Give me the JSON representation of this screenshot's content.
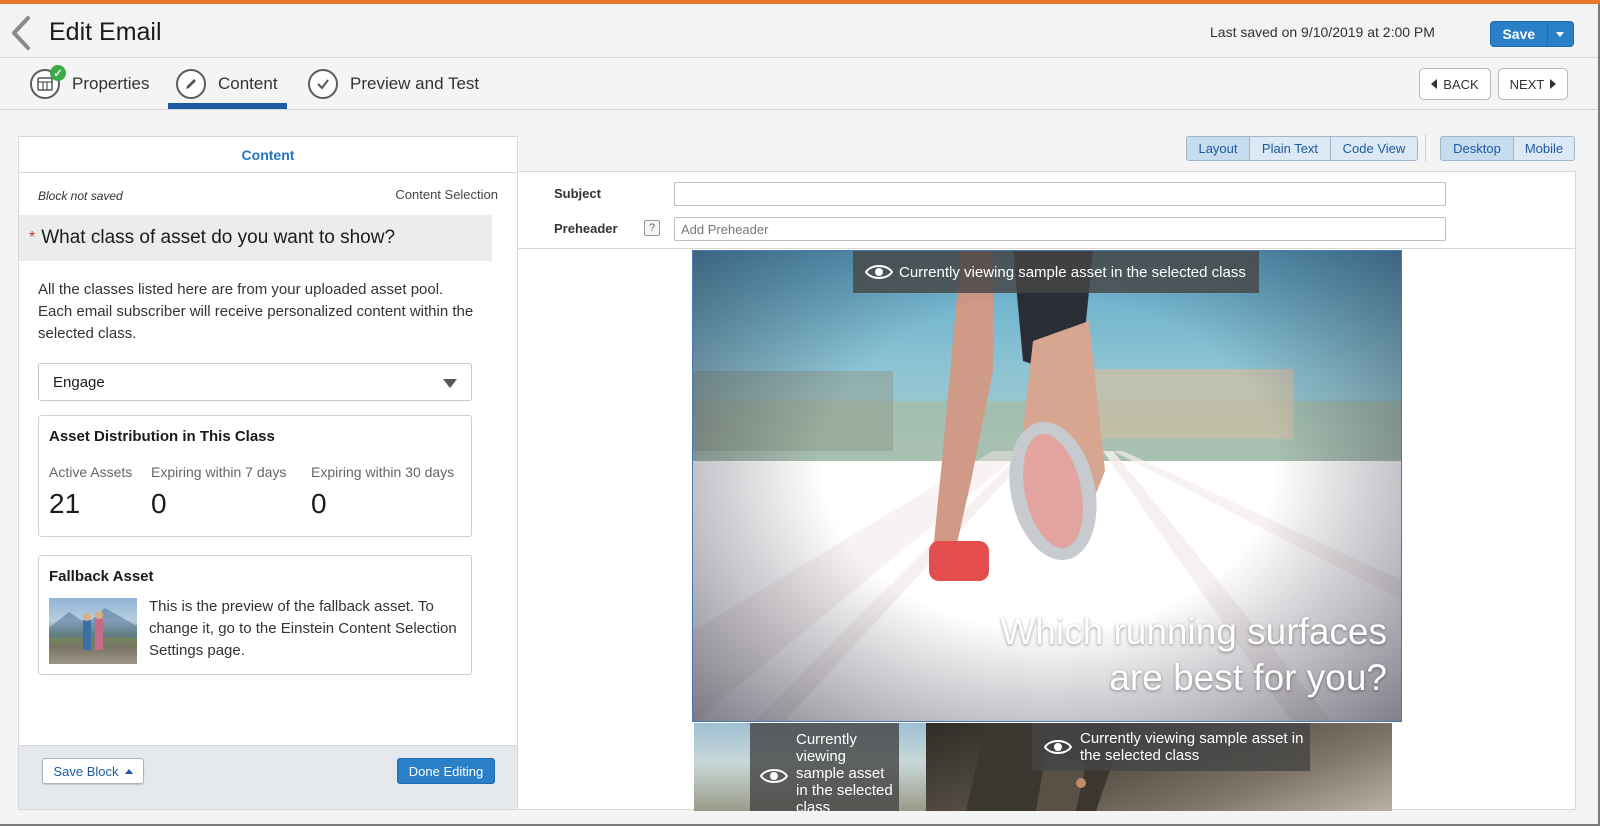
{
  "header": {
    "title": "Edit Email",
    "last_saved": "Last saved on 9/10/2019 at 2:00 PM",
    "save_label": "Save"
  },
  "steps": [
    {
      "label": "Properties",
      "icon": "grid-icon",
      "completed": true
    },
    {
      "label": "Content",
      "icon": "pencil-icon",
      "active": true
    },
    {
      "label": "Preview and Test",
      "icon": "check-icon"
    }
  ],
  "nav": {
    "back_label": "BACK",
    "next_label": "NEXT"
  },
  "left_panel": {
    "heading": "Content",
    "block_status": "Block not saved",
    "section_label": "Content Selection",
    "question": "What class of asset do you want to show?",
    "description": "All the classes listed here are from your uploaded asset pool. Each email subscriber will receive personalized content within the selected class.",
    "selected_class": "Engage",
    "distribution": {
      "title": "Asset Distribution in This Class",
      "stats": [
        {
          "label": "Active Assets",
          "value": "21"
        },
        {
          "label": "Expiring within 7 days",
          "value": "0"
        },
        {
          "label": "Expiring within 30 days",
          "value": "0"
        }
      ]
    },
    "fallback": {
      "title": "Fallback Asset",
      "text": "This is the preview of the fallback asset. To change it, go to the Einstein Content Selection Settings page."
    },
    "footer": {
      "save_block_label": "Save Block",
      "done_label": "Done Editing"
    }
  },
  "view_toolbar": {
    "modes": [
      "Layout",
      "Plain Text",
      "Code View"
    ],
    "devices": [
      "Desktop",
      "Mobile"
    ]
  },
  "email": {
    "subject_label": "Subject",
    "subject_value": "",
    "preheader_label": "Preheader",
    "preheader_placeholder": "Add Preheader",
    "help_glyph": "?",
    "hero_overlay": "Currently viewing sample asset in the selected class",
    "hero_heading": "Which running surfaces are best for you?",
    "sub_overlay_left": "Currently viewing sample asset in the selected class",
    "sub_overlay_right": "Currently viewing sample asset in the selected class"
  },
  "colors": {
    "accent": "#e8782c",
    "primary_button": "#2a7fc9",
    "link_blue": "#2574c6",
    "required": "#c23934",
    "success": "#3bab48"
  }
}
